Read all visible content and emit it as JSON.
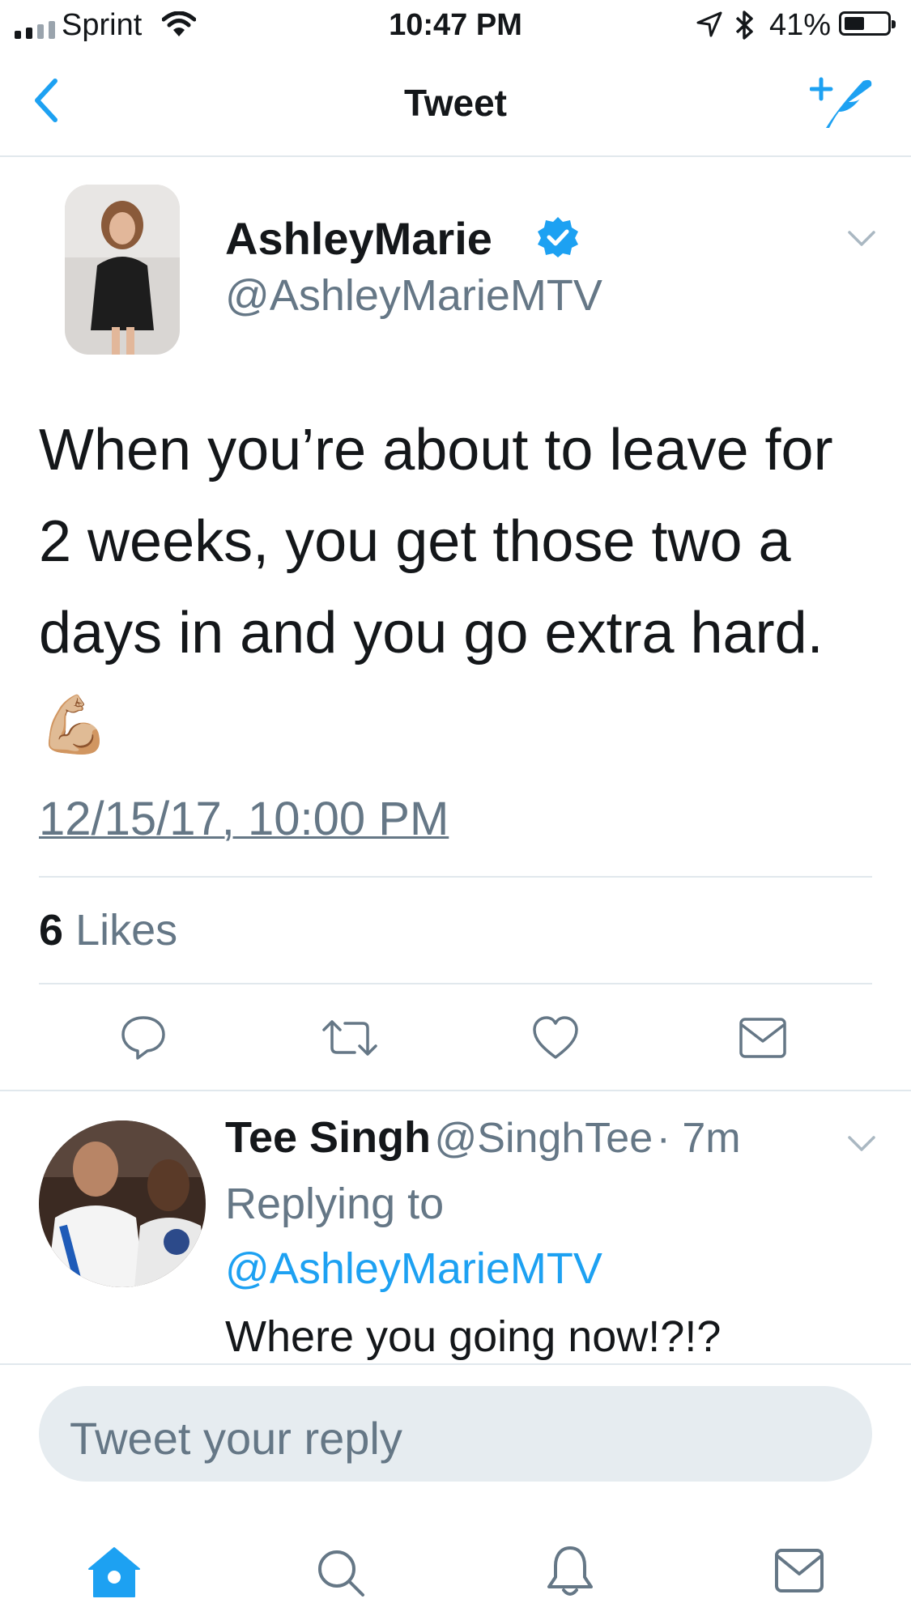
{
  "status_bar": {
    "carrier": "Sprint",
    "time": "10:47 PM",
    "battery": "41%"
  },
  "nav": {
    "title": "Tweet"
  },
  "tweet": {
    "author_name": "AshleyMarie",
    "author_handle": "@AshleyMarieMTV",
    "verified": true,
    "text": "When you’re about to leave for 2 weeks, you get those two a days in and you go extra hard.",
    "emoji": "💪🏼",
    "timestamp": "12/15/17, 10:00 PM",
    "likes_count": "6",
    "likes_label": "Likes"
  },
  "reply": {
    "author_name": "Tee Singh",
    "author_handle": "@SinghTee",
    "time": "· 7m",
    "replying_to_label": "Replying to",
    "replying_to_handle": "@AshleyMarieMTV",
    "text": "Where you going now!?!?"
  },
  "composer": {
    "placeholder": "Tweet your reply"
  },
  "colors": {
    "accent": "#1da1f2",
    "muted": "#657786",
    "divider": "#e1e8ed"
  },
  "icons": [
    "back-chevron-icon",
    "compose-tweet-icon",
    "verified-badge-icon",
    "chevron-down-icon",
    "reply-icon",
    "retweet-icon",
    "like-icon",
    "dm-icon",
    "home-icon",
    "search-icon",
    "notifications-icon",
    "messages-icon"
  ]
}
